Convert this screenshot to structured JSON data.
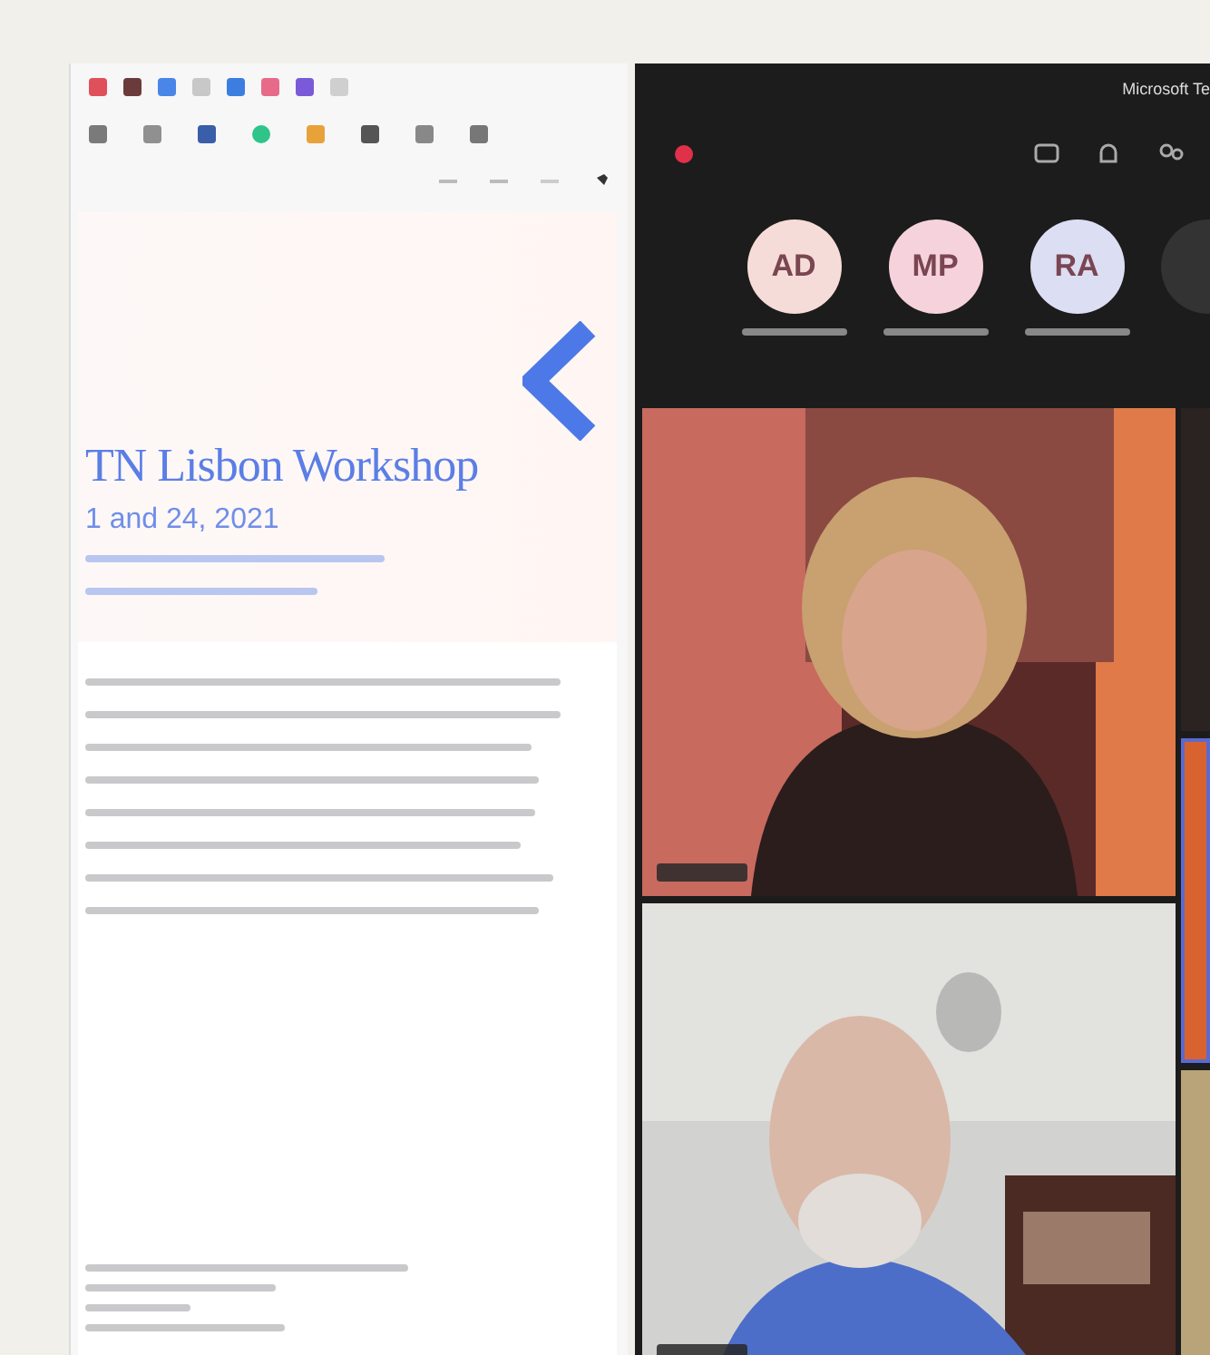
{
  "browser": {
    "page": {
      "title": "TN Lisbon Workshop",
      "date": "1 and 24, 2021"
    }
  },
  "meeting": {
    "window": {
      "title": "Microsoft Te"
    },
    "recording": true,
    "participants": [
      {
        "initials": "AD",
        "color": "#f6dcd8"
      },
      {
        "initials": "MP",
        "color": "#f6d3dc"
      },
      {
        "initials": "RA",
        "color": "#dcdef3"
      }
    ]
  }
}
